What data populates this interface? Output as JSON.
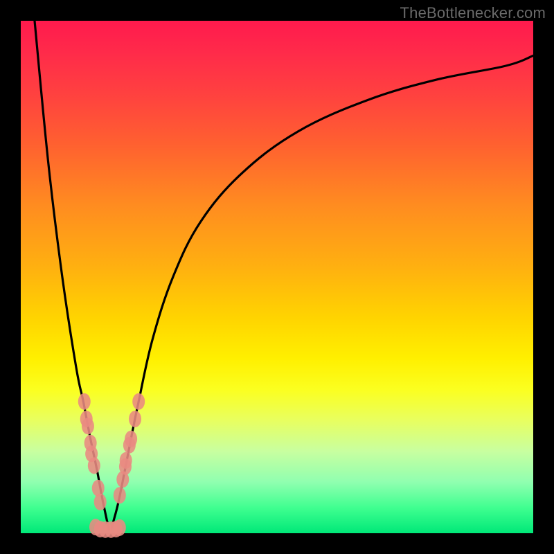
{
  "watermark": "TheBottlenecker.com",
  "colors": {
    "curve": "#000000",
    "marker": "#e98a82",
    "frame": "#000000"
  },
  "chart_data": {
    "type": "line",
    "title": "",
    "xlabel": "",
    "ylabel": "",
    "xlim": [
      0,
      100
    ],
    "ylim": [
      0,
      100
    ],
    "note": "Values are approximate percentages of the 740px inner plot area (0=left/bottom, 100=right/top for x/y). The two curves form a V with minimum near x≈17.",
    "series": [
      {
        "name": "left-curve",
        "x": [
          2.7,
          5.4,
          8.1,
          10.8,
          12.2,
          13.5,
          14.9,
          15.9,
          17.2
        ],
        "y": [
          100,
          72.0,
          50.0,
          32.4,
          25.7,
          18.9,
          12.2,
          6.8,
          0.7
        ]
      },
      {
        "name": "right-curve",
        "x": [
          17.6,
          18.9,
          20.3,
          21.6,
          23.0,
          25.7,
          29.7,
          35.1,
          43.2,
          54.1,
          67.6,
          81.1,
          94.6,
          100.0
        ],
        "y": [
          0.7,
          5.4,
          12.2,
          18.9,
          25.7,
          37.8,
          50.0,
          60.8,
          70.3,
          78.4,
          84.5,
          88.5,
          91.2,
          93.2
        ]
      }
    ],
    "markers": {
      "name": "highlight-points",
      "note": "Pink dot clusters near the V-bottom on both branches.",
      "points": [
        {
          "x": 12.4,
          "y": 25.7
        },
        {
          "x": 12.8,
          "y": 22.3
        },
        {
          "x": 13.1,
          "y": 20.9
        },
        {
          "x": 13.6,
          "y": 17.6
        },
        {
          "x": 13.8,
          "y": 15.5
        },
        {
          "x": 14.3,
          "y": 13.2
        },
        {
          "x": 15.1,
          "y": 8.8
        },
        {
          "x": 15.5,
          "y": 6.1
        },
        {
          "x": 14.6,
          "y": 1.2
        },
        {
          "x": 15.5,
          "y": 0.8
        },
        {
          "x": 16.5,
          "y": 0.7
        },
        {
          "x": 17.6,
          "y": 0.7
        },
        {
          "x": 18.6,
          "y": 0.8
        },
        {
          "x": 19.3,
          "y": 1.1
        },
        {
          "x": 19.3,
          "y": 7.4
        },
        {
          "x": 19.9,
          "y": 10.5
        },
        {
          "x": 20.4,
          "y": 13.0
        },
        {
          "x": 20.5,
          "y": 14.2
        },
        {
          "x": 21.2,
          "y": 17.2
        },
        {
          "x": 21.5,
          "y": 18.4
        },
        {
          "x": 22.3,
          "y": 22.3
        },
        {
          "x": 23.0,
          "y": 25.7
        }
      ]
    }
  }
}
